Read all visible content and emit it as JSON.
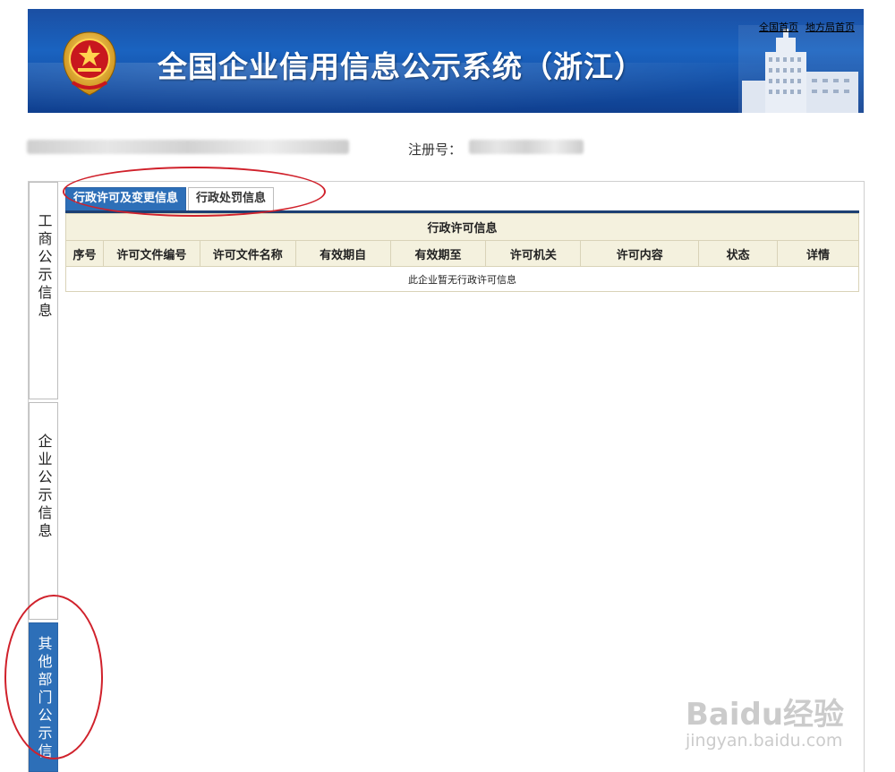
{
  "header": {
    "title": "全国企业信用信息公示系统（浙江）",
    "links": [
      "全国首页",
      "地方局首页"
    ]
  },
  "company": {
    "reg_label": "注册号："
  },
  "side_tabs": [
    {
      "label": "工商公示信息",
      "active": false
    },
    {
      "label": "企业公示信息",
      "active": false
    },
    {
      "label": "其他部门公示信",
      "active": true
    }
  ],
  "tabs": [
    {
      "label": "行政许可及变更信息",
      "active": true
    },
    {
      "label": "行政处罚信息",
      "active": false
    }
  ],
  "table": {
    "caption": "行政许可信息",
    "columns": [
      "序号",
      "许可文件编号",
      "许可文件名称",
      "有效期自",
      "有效期至",
      "许可机关",
      "许可内容",
      "状态",
      "详情"
    ],
    "empty_message": "此企业暂无行政许可信息"
  },
  "watermark": {
    "logo": "Baidu经验",
    "sub": "jingyan.baidu.com"
  },
  "colors": {
    "tab_active": "#2d6fb8",
    "banner": "#1a63c0",
    "table_header": "#f4f1de",
    "annotation": "#d0212b"
  }
}
